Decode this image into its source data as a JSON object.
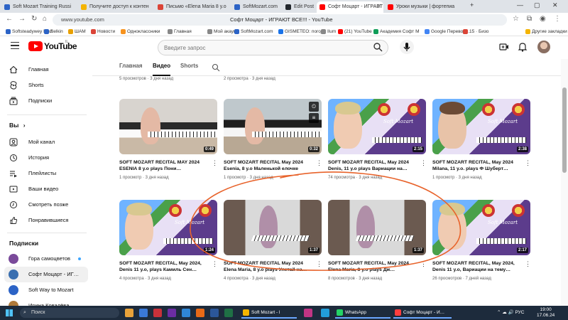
{
  "browser": {
    "tabs": [
      {
        "label": "Soft Mozart Training Russi",
        "color": "#2c63c6"
      },
      {
        "label": "Получите доступ к контен",
        "color": "#f4b400"
      },
      {
        "label": "Письмо «Elena Maria 8 y.o",
        "color": "#db4437"
      },
      {
        "label": "SoftMozart.com",
        "color": "#2c63c6"
      },
      {
        "label": "Edit Post",
        "color": "#23282d"
      },
      {
        "label": "Софт Моцарт - ИГРАЕТ",
        "color": "#ff0000",
        "active": true
      },
      {
        "label": "Уроки музыки | фортепиа",
        "color": "#ff0000"
      }
    ],
    "window_controls": [
      "—",
      "▢",
      "✕"
    ],
    "url": "www.youtube.com",
    "page_title": "Софт Моцарт - ИГРАЮТ ВСЕ!!! - YouTube",
    "bookmarks": [
      {
        "label": "Softsteadywey Moz.",
        "color": "#2c63c6"
      },
      {
        "label": "Belkin",
        "color": "#2c63c6"
      },
      {
        "label": "ШАМ",
        "color": "#e8a000"
      },
      {
        "label": "Новости",
        "color": "#db4437"
      },
      {
        "label": "Одноклассники",
        "color": "#f7931e"
      },
      {
        "label": "Главная",
        "color": "#888"
      },
      {
        "label": "Мой акаунт",
        "color": "#888"
      },
      {
        "label": "SoftMozart.com",
        "color": "#2c63c6"
      },
      {
        "label": "GISMETEO: погод",
        "color": "#1a73e8"
      },
      {
        "label": "Ilum",
        "color": "#888"
      },
      {
        "label": "(21) YouTube",
        "color": "#ff0000"
      },
      {
        "label": "Академия Софт М",
        "color": "#0f9d58"
      },
      {
        "label": "Google Переводч.",
        "color": "#4285f4"
      },
      {
        "label": "15 · Бизо",
        "color": "#db4437"
      },
      {
        "label": "Другие закладки",
        "color": "#f4b400"
      }
    ]
  },
  "youtube": {
    "wordmark": "YouTube",
    "region": "IL",
    "search_placeholder": "Введите запрос"
  },
  "sidebar": {
    "items": [
      {
        "label": "Главная",
        "icon": "home-icon"
      },
      {
        "label": "Shorts",
        "icon": "shorts-icon"
      },
      {
        "label": "Подписки",
        "icon": "subscriptions-icon"
      }
    ],
    "you_header": "Вы",
    "you_chevron": "›",
    "you_items": [
      {
        "label": "Мой канал",
        "icon": "channel-icon"
      },
      {
        "label": "История",
        "icon": "history-icon"
      },
      {
        "label": "Плейлисты",
        "icon": "playlists-icon"
      },
      {
        "label": "Ваши видео",
        "icon": "your-videos-icon"
      },
      {
        "label": "Смотреть позже",
        "icon": "watch-later-icon"
      },
      {
        "label": "Понравившиеся",
        "icon": "liked-icon"
      }
    ],
    "subs_header": "Подписки",
    "subscriptions": [
      {
        "label": "Гора самоцветов",
        "color": "#7a4a9a",
        "live": true
      },
      {
        "label": "Софт Моцарт - ИГ…",
        "color": "#3a6fb0",
        "selected": true
      },
      {
        "label": "Soft Way to Mozart",
        "color": "#2c63c6"
      },
      {
        "label": "Ирина Ковалёва",
        "color": "#b07a3a"
      }
    ]
  },
  "channel_tabs": [
    {
      "label": "Главная"
    },
    {
      "label": "Видео",
      "active": true
    },
    {
      "label": "Shorts"
    }
  ],
  "prev_row_meta": [
    "5 просмотров · 3 дня назад",
    "2 просмотра · 3 дня назад",
    "",
    ""
  ],
  "videos": [
    {
      "title": "SOFT MOZART RECITAL MAY 2024 ESENIA 8 y.o plays Пони…",
      "meta": "1 просмотр · 3 дня назад",
      "duration": "0:49",
      "art": "piano"
    },
    {
      "title": "SOFT MOZART RECITAL May 2024 Esenia, 8 y.o Маленькой елочке",
      "meta": "1 просмотр · 3 дня назад",
      "duration": "0:32",
      "art": "piano2"
    },
    {
      "title": "SOFT MOZART RECITAL, May 2024 Denis, 11 y.o plays Вариации на…",
      "meta": "74 просмотра · 3 дня назад",
      "duration": "2:15",
      "art": "portrait"
    },
    {
      "title": "SOFT MOZART RECITAL, May 2024 Milana, 11 y.o. plays Ф Шуберт…",
      "meta": "1 просмотр · 3 дня назад",
      "duration": "2:38",
      "art": "portrait2"
    },
    {
      "title": "SOFT MOZART RECITAL, May 2024, Denis 11 y.o, plays Камиль Сен…",
      "meta": "4 просмотра · 3 дня назад",
      "duration": "1:24",
      "art": "portrait"
    },
    {
      "title": "SOFT MOZART RECITAL May 2024 Elena Maria, 8 y.o plays Улетай на…",
      "meta": "4 просмотра · 3 дня назад",
      "duration": "1:37",
      "art": "room"
    },
    {
      "title": "SOFT MOZART RECITAL, May 2024 Elena Maria, 8 y.o plays Дж…",
      "meta": "8 просмотров · 3 дня назад",
      "duration": "1:37",
      "art": "room2"
    },
    {
      "title": "SOFT MOZART RECITAL, May 2024, Denis 11 y.o, Вариации на тему…",
      "meta": "26 просмотров · 7 дней назад",
      "duration": "2:17",
      "art": "portrait"
    }
  ],
  "banner_text": "Soft Mozart",
  "annotation_color": "#e8632b",
  "taskbar": {
    "search_label": "Поиск",
    "apps": [
      {
        "label": "Soft Mozart - l",
        "color": "#f4b400"
      },
      {
        "label": "WhatsApp",
        "color": "#25d366"
      },
      {
        "label": "Софт Моцарт - И…",
        "color": "#ff3d3d"
      }
    ],
    "tray_lang": "РУС",
    "time": "19:00",
    "date": "17.06.24"
  }
}
